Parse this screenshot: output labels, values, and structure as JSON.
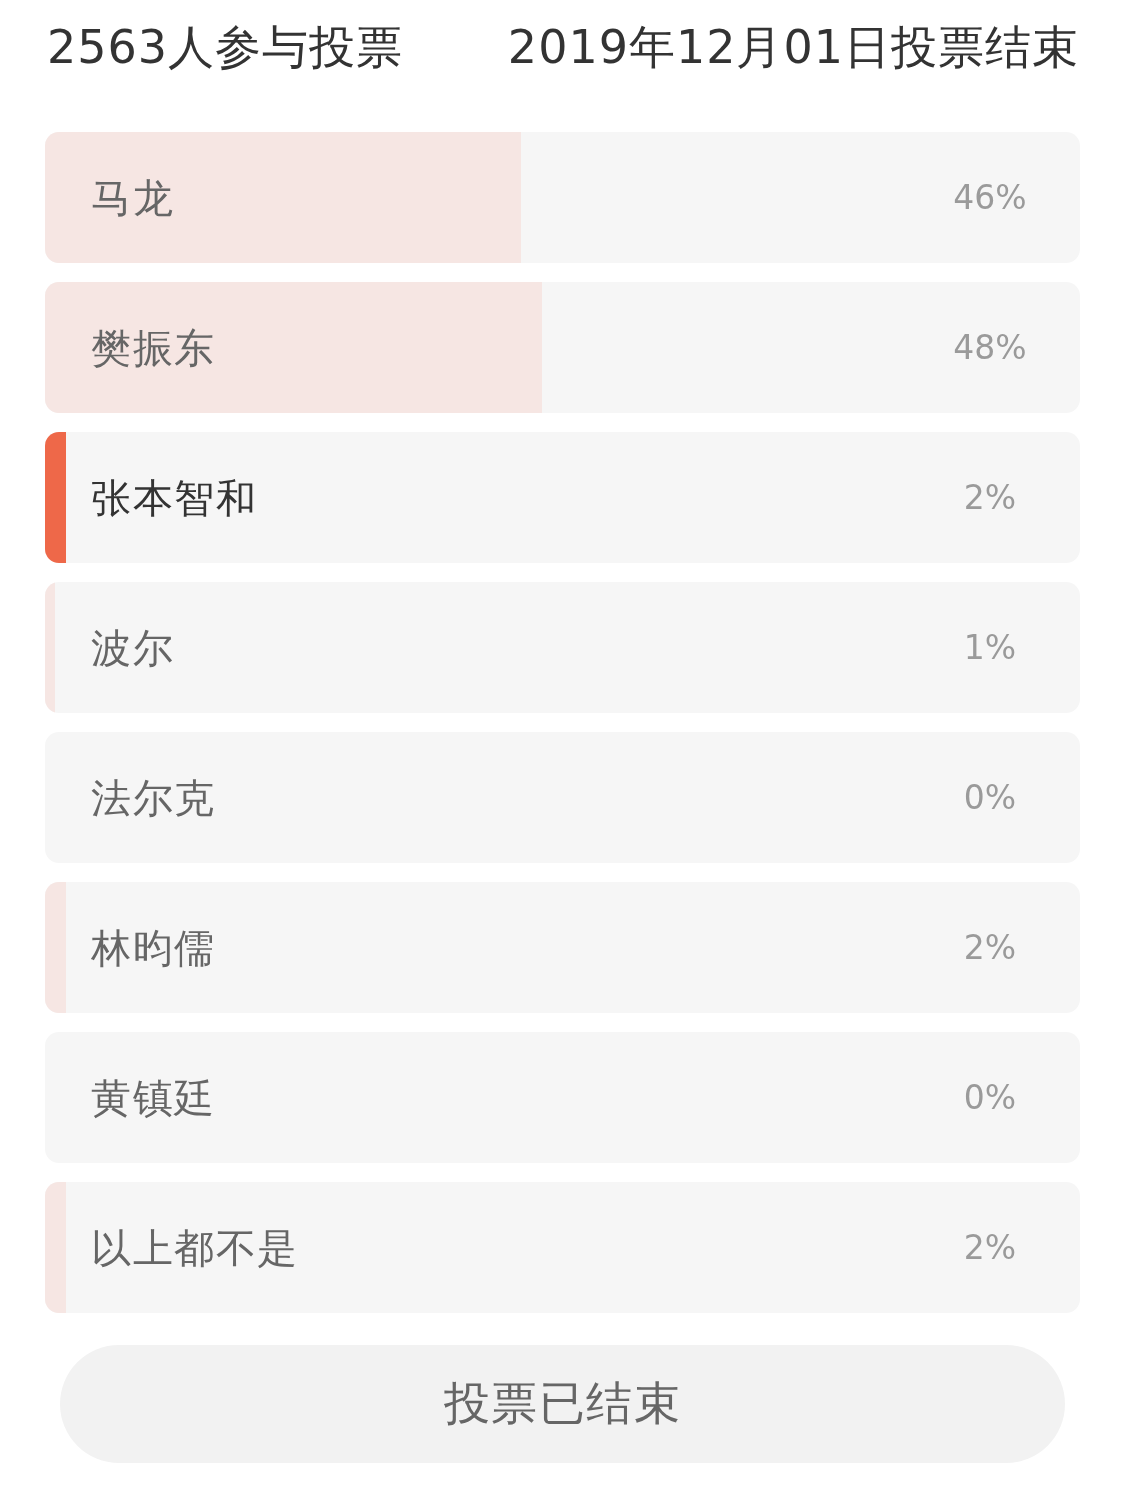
{
  "header": {
    "participants": "2563人参与投票",
    "deadline": "2019年12月01日投票结束"
  },
  "options": [
    {
      "name": "马龙",
      "percent": "46%",
      "level": 0.46,
      "selected": false
    },
    {
      "name": "樊振东",
      "percent": "48%",
      "level": 0.48,
      "selected": false
    },
    {
      "name": "张本智和",
      "percent": "2%",
      "level": 0.02,
      "selected": true
    },
    {
      "name": "波尔",
      "percent": "1%",
      "level": 0.01,
      "selected": false
    },
    {
      "name": "法尔克",
      "percent": "0%",
      "level": 0,
      "selected": false
    },
    {
      "name": "林昀儒",
      "percent": "2%",
      "level": 0.02,
      "selected": false
    },
    {
      "name": "黄镇廷",
      "percent": "0%",
      "level": 0,
      "selected": false
    },
    {
      "name": "以上都不是",
      "percent": "2%",
      "level": 0.02,
      "selected": false
    }
  ],
  "button": {
    "label": "投票已结束",
    "disabled": true
  }
}
